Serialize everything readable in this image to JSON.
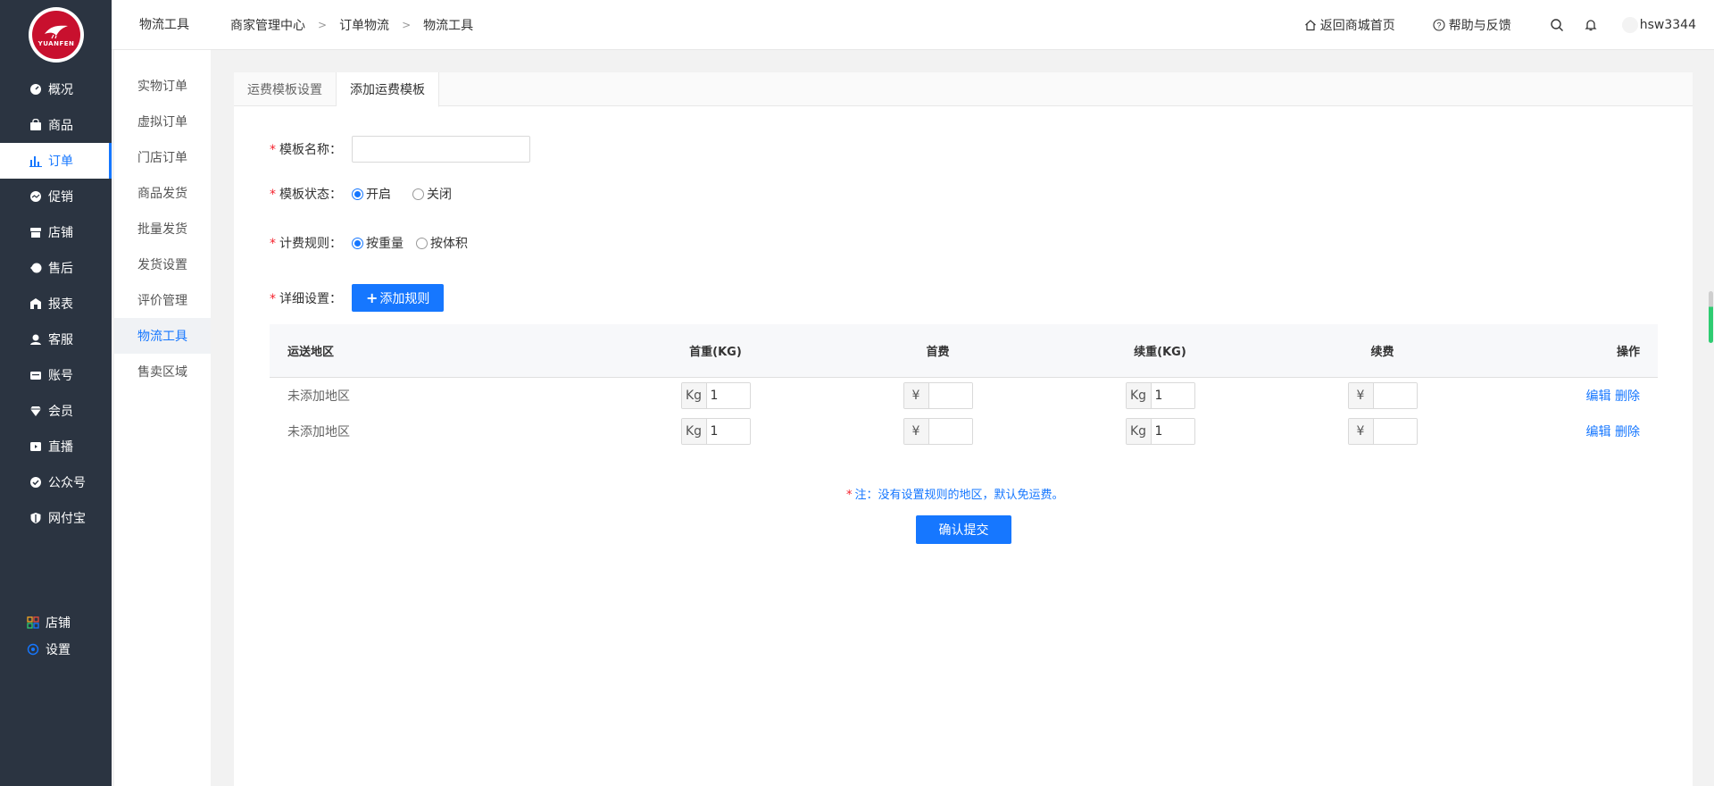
{
  "sidebar": {
    "logo_text": "YUANFEN",
    "items": [
      {
        "label": "概况",
        "icon": "dashboard-icon",
        "active": false
      },
      {
        "label": "商品",
        "icon": "bag-icon",
        "active": false
      },
      {
        "label": "订单",
        "icon": "bar-chart-icon",
        "active": true
      },
      {
        "label": "促销",
        "icon": "promo-icon",
        "active": false
      },
      {
        "label": "店铺",
        "icon": "store-icon",
        "active": false
      },
      {
        "label": "售后",
        "icon": "aftersale-icon",
        "active": false
      },
      {
        "label": "报表",
        "icon": "report-icon",
        "active": false
      },
      {
        "label": "客服",
        "icon": "service-icon",
        "active": false
      },
      {
        "label": "账号",
        "icon": "wallet-icon",
        "active": false
      },
      {
        "label": "会员",
        "icon": "diamond-icon",
        "active": false
      },
      {
        "label": "直播",
        "icon": "live-icon",
        "active": false
      },
      {
        "label": "公众号",
        "icon": "check-badge-icon",
        "active": false
      },
      {
        "label": "网付宝",
        "icon": "shield-icon",
        "active": false
      }
    ],
    "bottom": [
      {
        "label": "店铺",
        "icon": "grid-icon"
      },
      {
        "label": "设置",
        "icon": "settings-icon"
      }
    ]
  },
  "subnav": {
    "items": [
      {
        "label": "实物订单",
        "active": false
      },
      {
        "label": "虚拟订单",
        "active": false
      },
      {
        "label": "门店订单",
        "active": false
      },
      {
        "label": "商品发货",
        "active": false
      },
      {
        "label": "批量发货",
        "active": false
      },
      {
        "label": "发货设置",
        "active": false
      },
      {
        "label": "评价管理",
        "active": false
      },
      {
        "label": "物流工具",
        "active": true
      },
      {
        "label": "售卖区域",
        "active": false
      }
    ]
  },
  "header": {
    "title": "物流工具",
    "breadcrumb": [
      "商家管理中心",
      "订单物流",
      "物流工具"
    ],
    "home_link": "返回商城首页",
    "help_link": "帮助与反馈",
    "username": "hsw3344"
  },
  "tabs": [
    {
      "label": "运费模板设置",
      "active": false
    },
    {
      "label": "添加运费模板",
      "active": true
    }
  ],
  "form": {
    "name_label": "模板名称：",
    "name_value": "",
    "status_label": "模板状态：",
    "status_options": [
      "开启",
      "关闭"
    ],
    "status_selected": 0,
    "rule_label": "计费规则：",
    "rule_options": [
      "按重量",
      "按体积"
    ],
    "rule_selected": 0,
    "detail_label": "详细设置：",
    "add_rule_button": "添加规则"
  },
  "table": {
    "headers": [
      "运送地区",
      "首重(KG)",
      "首费",
      "续重(KG)",
      "续费",
      "操作"
    ],
    "rows": [
      {
        "region": "未添加地区",
        "first_weight": "1",
        "first_fee": "",
        "add_weight": "1",
        "add_fee": "",
        "edit": "编辑",
        "delete": "删除"
      },
      {
        "region": "未添加地区",
        "first_weight": "1",
        "first_fee": "",
        "add_weight": "1",
        "add_fee": "",
        "edit": "编辑",
        "delete": "删除"
      }
    ],
    "weight_unit": "Kg",
    "currency": "¥"
  },
  "note": "注：没有设置规则的地区，默认免运费。",
  "submit_label": "确认提交",
  "colors": {
    "accent": "#1677ff",
    "sidebar": "#2b3441",
    "required": "#f5222d"
  }
}
